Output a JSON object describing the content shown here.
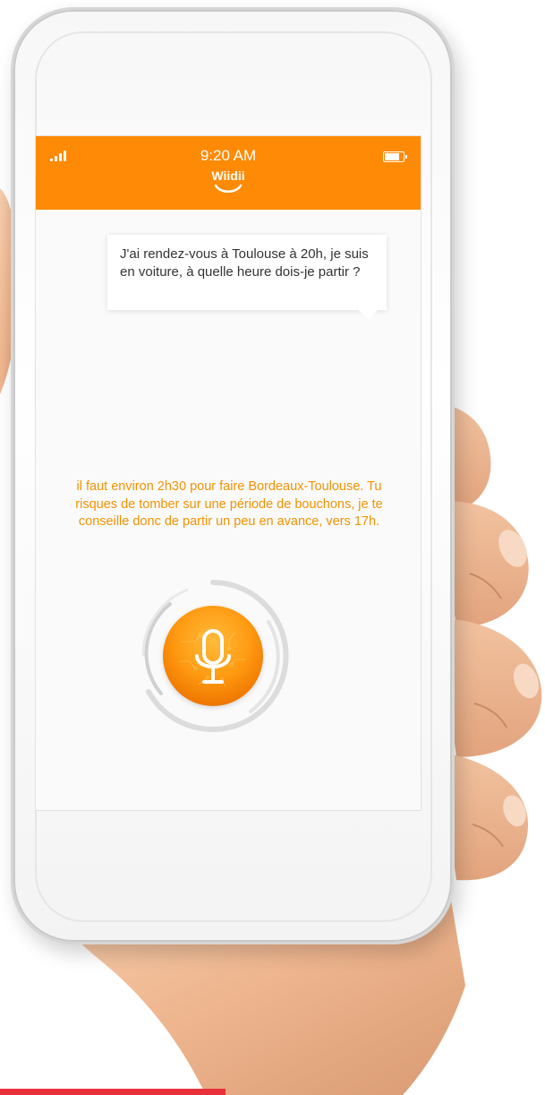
{
  "status_bar": {
    "time": "9:20 AM",
    "app_logo": "Wiidii",
    "icons": [
      "signal-icon",
      "battery-icon"
    ],
    "battery_level": 0.8
  },
  "conversation": {
    "user_message": "J'ai rendez-vous à Toulouse à 20h, je suis en voiture, à quelle heure dois-je partir ?",
    "assistant_reply": "il faut environ 2h30 pour faire Bordeaux-Toulouse. Tu risques de tomber sur une période de bouchons, je te conseille donc de partir un peu en avance, vers 17h."
  },
  "mic_button": {
    "icon": "microphone-icon"
  },
  "colors": {
    "brand_orange": "#ff8a05",
    "reply_text": "#f39200",
    "screen_background": "#fafafa",
    "accent_red": "#e8303a"
  }
}
